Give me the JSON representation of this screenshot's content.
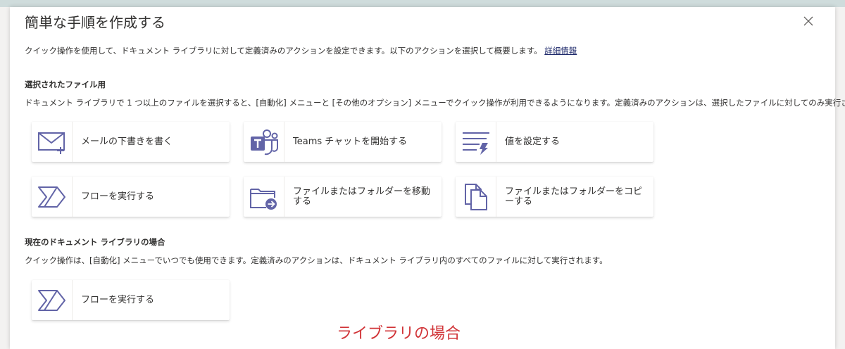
{
  "dialog": {
    "title": "簡単な手順を作成する",
    "close_icon": "close-icon",
    "intro_text": "クイック操作を使用して、ドキュメント ライブラリに対して定義済みのアクションを設定できます。以下のアクションを選択して概要します。",
    "learn_more": "詳細情報"
  },
  "selected_files": {
    "heading": "選択されたファイル用",
    "description": "ドキュメント ライブラリで 1 つ以上のファイルを選択すると、[自動化] メニューと [その他のオプション] メニューでクイック操作が利用できるようになります。定義済みのアクションは、選択したファイルに対してのみ実行されます。",
    "cards": [
      {
        "label": "メールの下書きを書く",
        "icon": "mail-compose-icon"
      },
      {
        "label": "Teams チャットを開始する",
        "icon": "teams-icon"
      },
      {
        "label": "値を設定する",
        "icon": "set-value-icon"
      },
      {
        "label": "フローを実行する",
        "icon": "power-automate-icon"
      },
      {
        "label": "ファイルまたはフォルダーを移動する",
        "icon": "move-folder-icon"
      },
      {
        "label": "ファイルまたはフォルダーをコピーする",
        "icon": "copy-file-icon"
      }
    ]
  },
  "current_library": {
    "heading": "現在のドキュメント ライブラリの場合",
    "description": "クイック操作は、[自動化] メニューでいつでも使用できます。定義済みのアクションは、ドキュメント ライブラリ内のすべてのファイルに対して実行されます。",
    "cards": [
      {
        "label": "フローを実行する",
        "icon": "power-automate-icon"
      }
    ]
  },
  "annotation": {
    "text": "ライブラリの場合",
    "color": "#d13438"
  },
  "colors": {
    "icon_purple": "#6264a7",
    "link": "#1f2a6b"
  }
}
